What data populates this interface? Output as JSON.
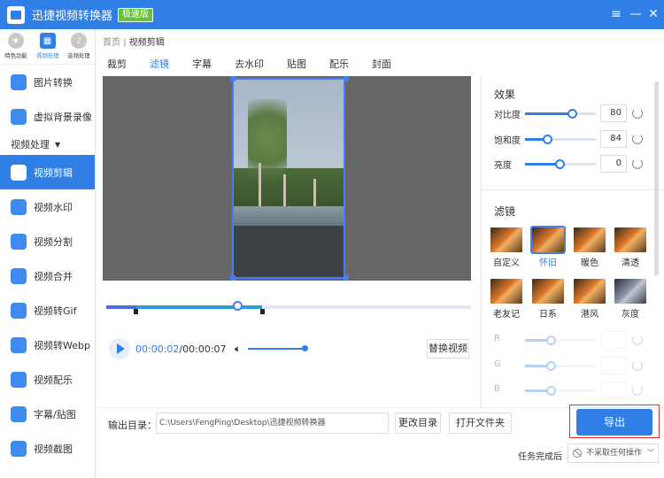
{
  "app": {
    "title": "迅捷视频转换器",
    "badge": "极速版"
  },
  "window": {
    "menu_icon": "menu-icon",
    "minimize_icon": "minimize-icon",
    "close_icon": "close-icon"
  },
  "sidebar": {
    "top_tabs": [
      {
        "label": "特色功能",
        "icon": "star-icon"
      },
      {
        "label": "视频处理",
        "icon": "film-icon"
      },
      {
        "label": "音频处理",
        "icon": "audio-icon"
      }
    ],
    "pre_items": [
      {
        "label": "图片转换",
        "icon": "image-icon"
      },
      {
        "label": "虚拟背景录像",
        "icon": "virtual-background-icon"
      }
    ],
    "section": "视频处理",
    "items": [
      {
        "label": "视频剪辑",
        "icon": "video-edit-icon",
        "active": true
      },
      {
        "label": "视频水印",
        "icon": "watermark-icon"
      },
      {
        "label": "视频分割",
        "icon": "split-icon"
      },
      {
        "label": "视频合并",
        "icon": "merge-icon"
      },
      {
        "label": "视频转Gif",
        "icon": "gif-icon"
      },
      {
        "label": "视频转Webp",
        "icon": "webp-icon"
      },
      {
        "label": "视频配乐",
        "icon": "music-icon"
      },
      {
        "label": "字幕/贴图",
        "icon": "subtitle-star-icon"
      },
      {
        "label": "视频截图",
        "icon": "screenshot-icon"
      }
    ]
  },
  "breadcrumb": {
    "home": "首页",
    "current": "视频剪辑"
  },
  "tabs": [
    "裁剪",
    "滤镜",
    "字幕",
    "去水印",
    "贴图",
    "配乐",
    "封面"
  ],
  "active_tab": "滤镜",
  "player": {
    "current_time": "00:00:02",
    "total_time": "/00:00:07",
    "replace_button": "替换视频",
    "playhead_fraction": 0.36,
    "volume_fraction": 1.0
  },
  "effects": {
    "title": "效果",
    "sliders": [
      {
        "label": "对比度",
        "value": "80",
        "fraction": 0.68
      },
      {
        "label": "饱和度",
        "value": "84",
        "fraction": 0.32
      },
      {
        "label": "亮度",
        "value": "0",
        "fraction": 0.5
      }
    ]
  },
  "filters": {
    "title": "滤镜",
    "items": [
      {
        "label": "自定义"
      },
      {
        "label": "怀旧",
        "active": true
      },
      {
        "label": "暖色"
      },
      {
        "label": "清透"
      },
      {
        "label": "老友记"
      },
      {
        "label": "日系"
      },
      {
        "label": "港风"
      },
      {
        "label": "灰度"
      }
    ],
    "rgb": [
      {
        "label": "R",
        "fraction": 0.38
      },
      {
        "label": "G",
        "fraction": 0.38
      },
      {
        "label": "B",
        "fraction": 0.38
      }
    ]
  },
  "output": {
    "label": "输出目录：",
    "path": "C:\\Users\\FengPing\\Desktop\\迅捷视频转换器",
    "change_button": "更改目录",
    "open_button": "打开文件夹",
    "export_button": "导出"
  },
  "after_task": {
    "label": "任务完成后",
    "selected": "不采取任何操作"
  },
  "colors": {
    "accent": "#2f7fe6",
    "highlight_frame": "#e03030"
  }
}
